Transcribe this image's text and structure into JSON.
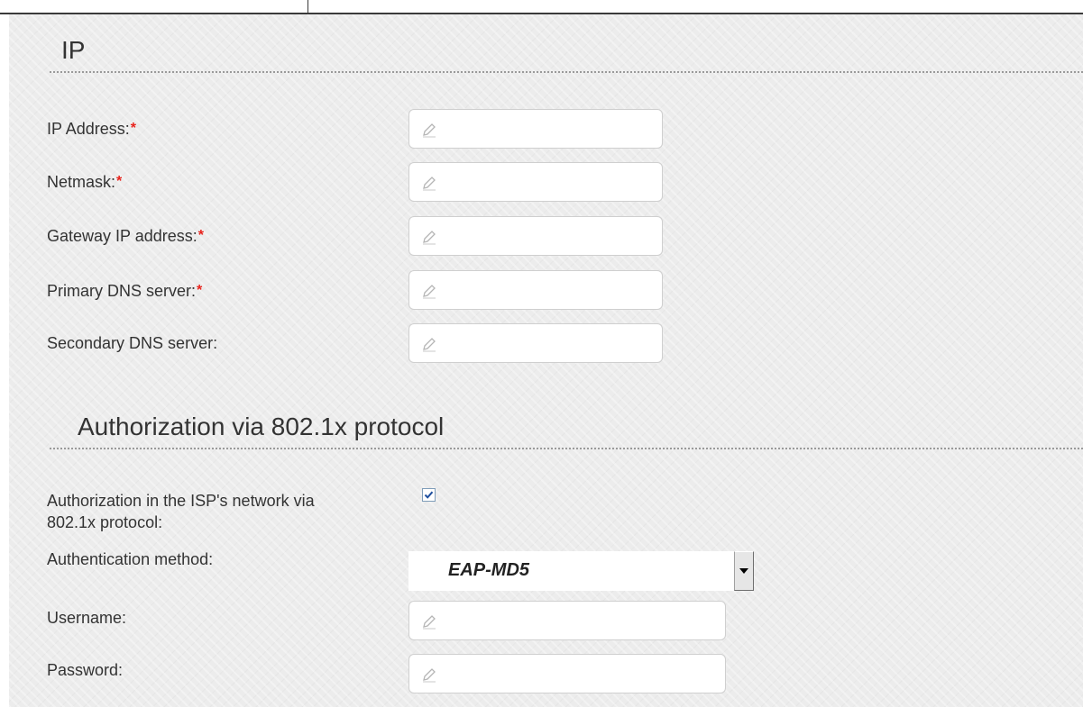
{
  "sections": {
    "ip": {
      "title": "IP"
    },
    "auth": {
      "title": "Authorization via 802.1x protocol"
    }
  },
  "fields": {
    "ip_address": {
      "label": "IP Address:",
      "required_mark": "*",
      "value": ""
    },
    "netmask": {
      "label": "Netmask:",
      "required_mark": "*",
      "value": ""
    },
    "gateway": {
      "label": "Gateway IP address:",
      "required_mark": "*",
      "value": ""
    },
    "primary_dns": {
      "label": "Primary DNS server:",
      "required_mark": "*",
      "value": ""
    },
    "secondary_dns": {
      "label": "Secondary DNS server:",
      "value": ""
    },
    "auth_enable": {
      "label_line1": "Authorization in the ISP's network via",
      "label_line2": "802.1x protocol:",
      "checked": true
    },
    "auth_method": {
      "label": "Authentication method:",
      "selected": "EAP-MD5"
    },
    "username": {
      "label": "Username:",
      "value": ""
    },
    "password": {
      "label": "Password:",
      "value": ""
    }
  },
  "colors": {
    "required": "#e8231c",
    "checkmark": "#1f4f9e"
  },
  "icons": {
    "edit": "pencil-icon",
    "dropdown": "chevron-down-icon"
  }
}
